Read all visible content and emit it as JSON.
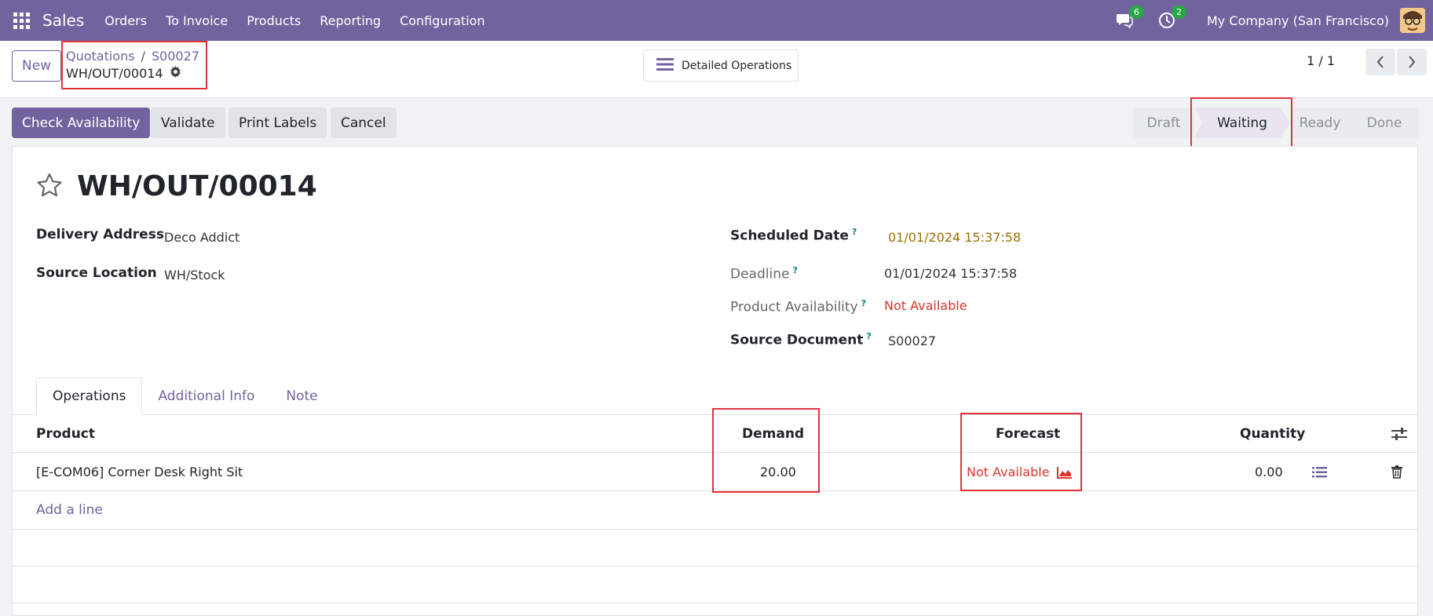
{
  "navbar": {
    "app_name": "Sales",
    "menu": [
      "Orders",
      "To Invoice",
      "Products",
      "Reporting",
      "Configuration"
    ],
    "messages_count": "6",
    "activities_count": "2",
    "company": "My Company (San Francisco)"
  },
  "control_panel": {
    "new_label": "New",
    "breadcrumb": [
      "Quotations",
      "S00027"
    ],
    "record_name": "WH/OUT/00014",
    "detailed_operations_label": "Detailed Operations",
    "pager": "1 / 1"
  },
  "actions": {
    "check_availability": "Check Availability",
    "validate": "Validate",
    "print_labels": "Print Labels",
    "cancel": "Cancel"
  },
  "statusbar": {
    "stages": [
      "Draft",
      "Waiting",
      "Ready",
      "Done"
    ],
    "active": "Waiting"
  },
  "form": {
    "title": "WH/OUT/00014",
    "delivery_address_label": "Delivery Address",
    "delivery_address": "Deco Addict",
    "source_location_label": "Source Location",
    "source_location": "WH/Stock",
    "scheduled_date_label": "Scheduled Date",
    "scheduled_date": "01/01/2024 15:37:58",
    "deadline_label": "Deadline",
    "deadline": "01/01/2024 15:37:58",
    "product_availability_label": "Product Availability",
    "product_availability": "Not Available",
    "source_document_label": "Source Document",
    "source_document": "S00027",
    "help_mark": "?"
  },
  "tabs": [
    "Operations",
    "Additional Info",
    "Note"
  ],
  "table": {
    "headers": {
      "product": "Product",
      "demand": "Demand",
      "forecast": "Forecast",
      "quantity": "Quantity"
    },
    "rows": [
      {
        "product": "[E-COM06] Corner Desk Right Sit",
        "demand": "20.00",
        "forecast": "Not Available",
        "quantity": "0.00"
      }
    ],
    "add_line": "Add a line"
  },
  "colors": {
    "brand": "#71639e",
    "danger": "#d9342b",
    "warning": "#a07000",
    "highlight": "#e0343a"
  }
}
